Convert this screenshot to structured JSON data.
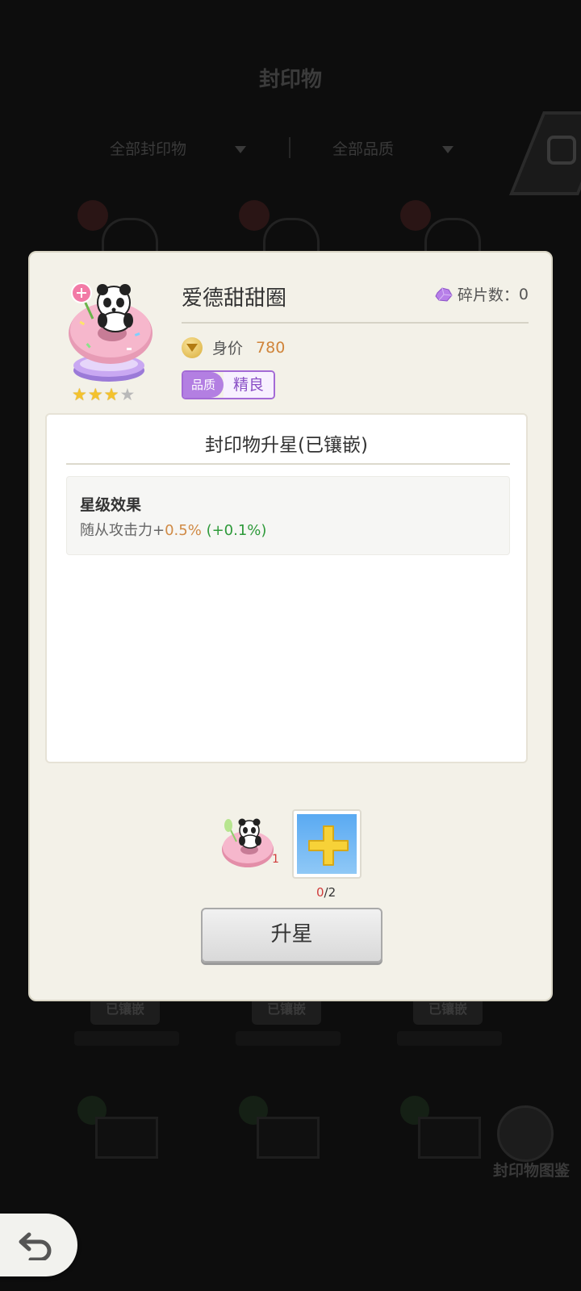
{
  "background": {
    "title": "封印物",
    "filter_type": "全部封印物",
    "filter_quality": "全部品质",
    "tags": [
      "已镶嵌",
      "已镶嵌",
      "已镶嵌"
    ],
    "codex_label": "封印物图鉴"
  },
  "modal": {
    "item_name": "爱德甜甜圈",
    "fragments": {
      "label": "碎片数：",
      "value": "0"
    },
    "price": {
      "label": "身价",
      "value": "780"
    },
    "quality": {
      "label": "品质",
      "value": "精良"
    },
    "stars": {
      "filled": 3,
      "total": 4
    },
    "panel": {
      "title": "封印物升星(已镶嵌)",
      "effect_heading": "星级效果",
      "effect_text": "随从攻击力+",
      "effect_value": "0.5%",
      "effect_increase": "(+0.1%)"
    },
    "cost": {
      "item_count": "1",
      "slot_current": "0",
      "slot_required": "/2"
    },
    "upgrade_label": "升星"
  },
  "colors": {
    "quality_purple": "#b37fe2",
    "price_orange": "#d0843a",
    "increase_green": "#2e9a3a",
    "count_red": "#d03b3b"
  },
  "icons": [
    "fragment-icon",
    "price-gem-icon",
    "plus-icon",
    "back-arrow-icon",
    "star-icon"
  ]
}
